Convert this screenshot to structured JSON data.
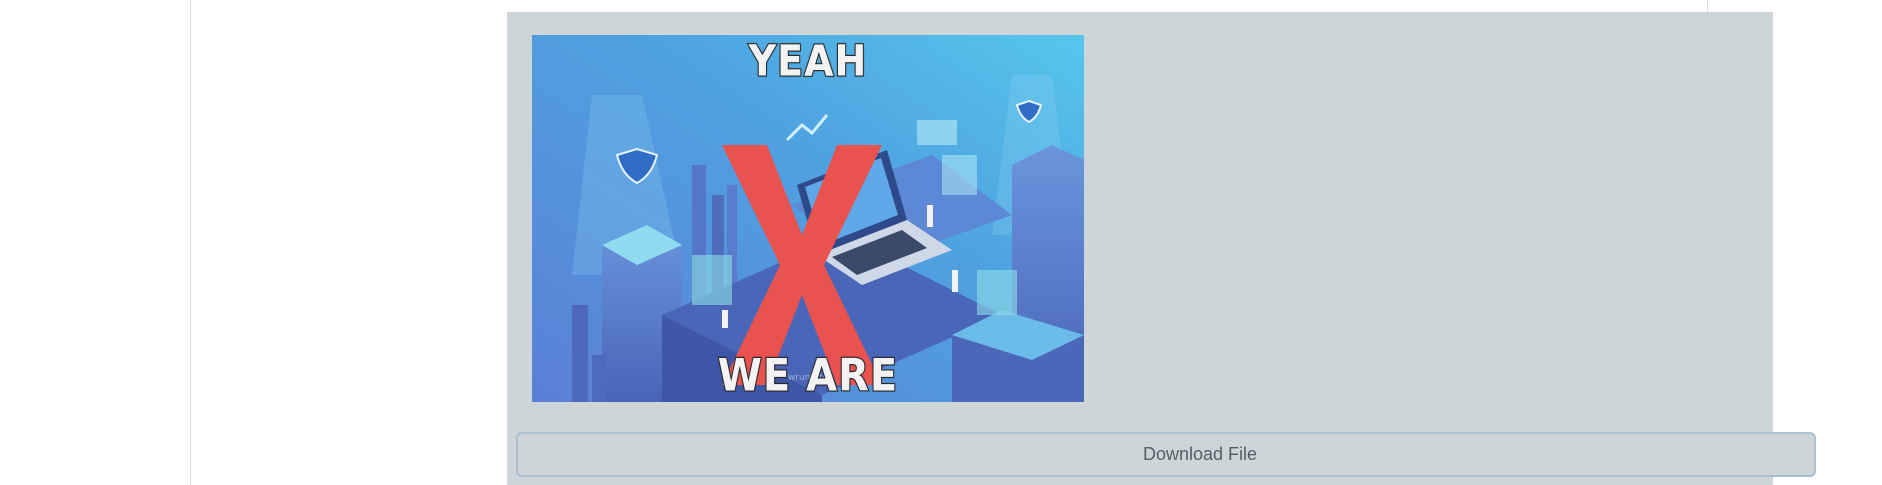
{
  "meme": {
    "top_text": "YEAH",
    "bottom_text": "WE ARE"
  },
  "actions": {
    "download_label": "Download File"
  },
  "colors": {
    "panel_background": "#ced5d9",
    "button_border": "#a9c0d2",
    "x_mark": "#e8524f"
  }
}
